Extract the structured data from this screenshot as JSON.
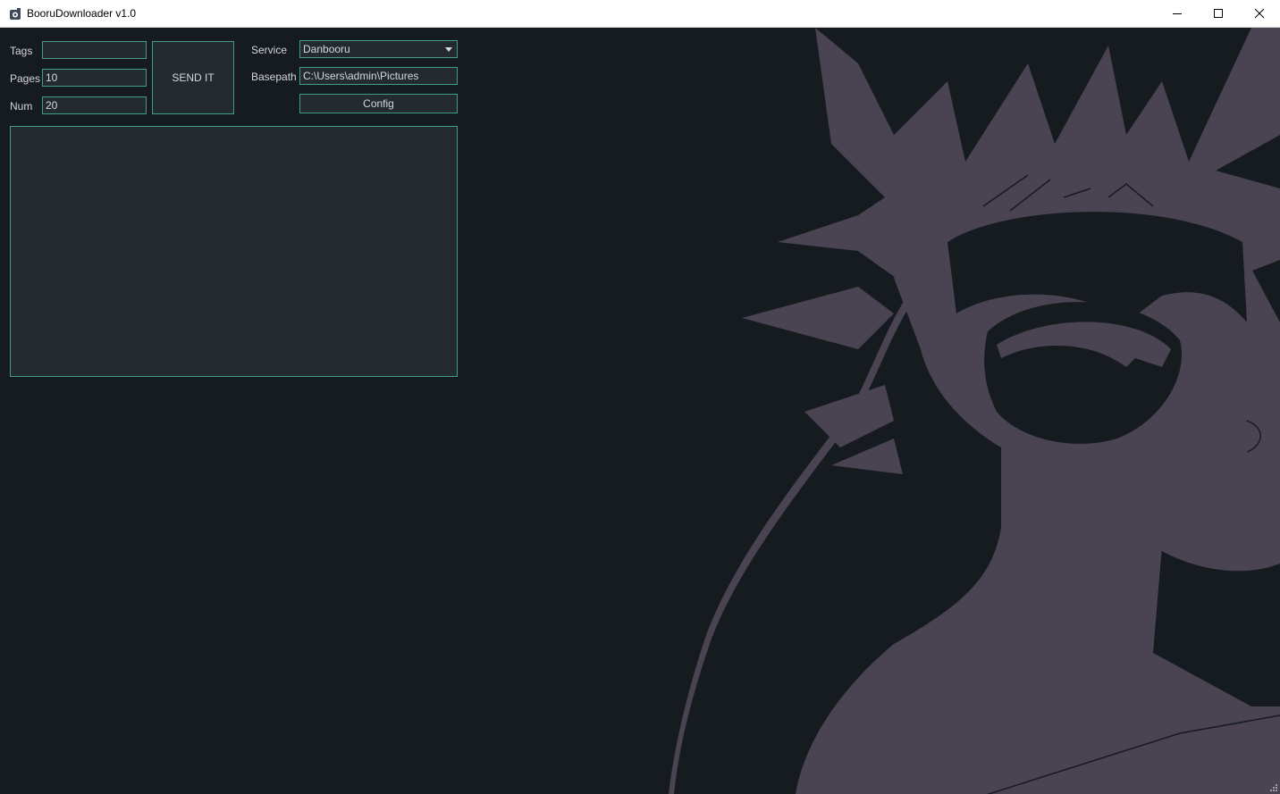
{
  "window": {
    "title": "BooruDownloader v1.0",
    "icon": "app-icon"
  },
  "form": {
    "tags_label": "Tags",
    "tags_value": "",
    "pages_label": "Pages",
    "pages_value": "10",
    "num_label": "Num",
    "num_value": "20",
    "send_label": "SEND IT",
    "service_label": "Service",
    "service_value": "Danbooru",
    "basepath_label": "Basepath",
    "basepath_value": "C:\\Users\\admin\\Pictures",
    "config_label": "Config"
  },
  "log": {
    "content": ""
  },
  "colors": {
    "background": "#161b20",
    "panel": "#232b2e",
    "accent_border": "#3f9e83",
    "text": "#d4d8dc",
    "art_silhouette": "#4a4452"
  }
}
